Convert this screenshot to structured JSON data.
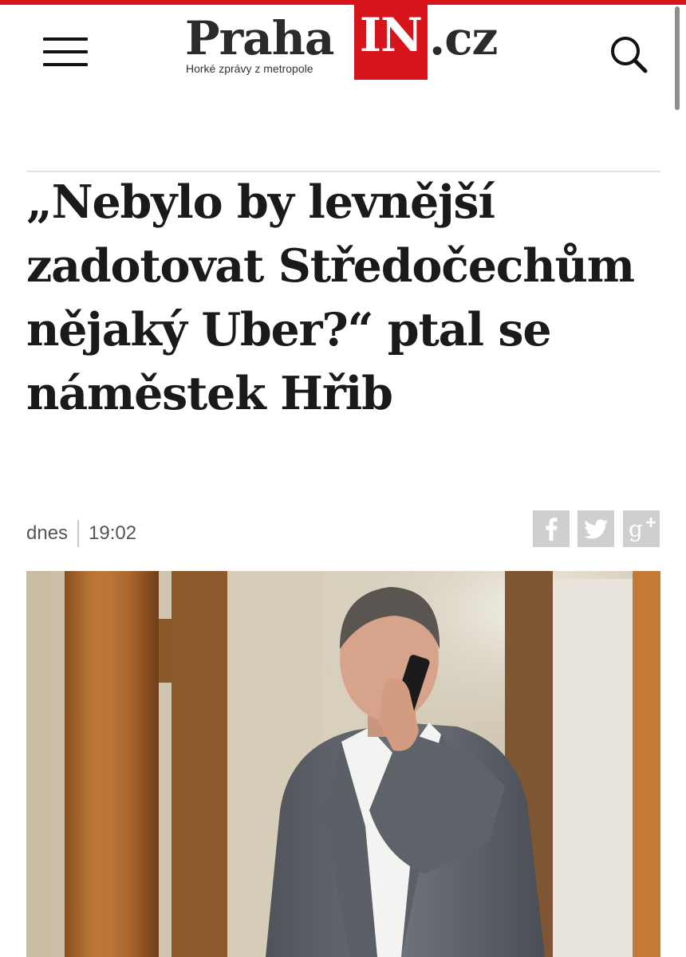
{
  "header": {
    "logo": {
      "praha": "Praha",
      "in": "IN",
      "cz": ".cz",
      "tagline": "Horké zprávy z metropole"
    },
    "menu_icon": "hamburger-menu-icon",
    "search_icon": "search-icon"
  },
  "article": {
    "headline": "„Nebylo by levnější zadotovat Středočechům nějaký Uber?“ ptal se náměstek Hřib",
    "meta": {
      "date": "dnes",
      "time": "19:02"
    },
    "share": [
      {
        "network": "Facebook",
        "icon": "facebook-icon"
      },
      {
        "network": "Twitter",
        "icon": "twitter-icon"
      },
      {
        "network": "Google+",
        "icon": "google-plus-icon"
      }
    ],
    "photo": {
      "subject": "man in grey suit talking on a mobile phone"
    }
  },
  "colors": {
    "brand_red": "#d7141a",
    "text": "#1a1a1a",
    "meta_text": "#555555",
    "share_bg": "#cfcfcf"
  }
}
